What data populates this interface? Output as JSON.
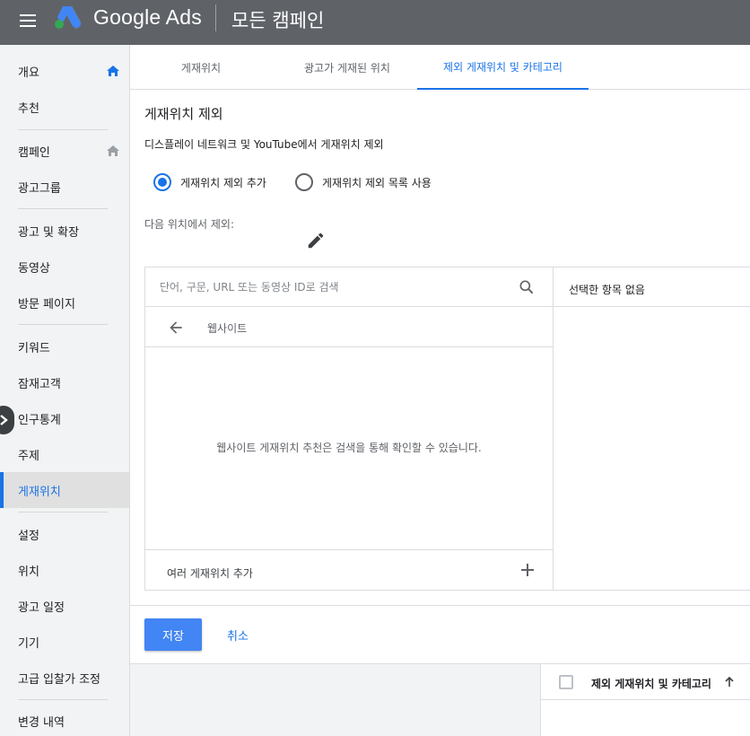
{
  "app": {
    "brand": "Google Ads",
    "page_title": "모든 캠페인"
  },
  "sidebar": {
    "items": [
      {
        "label": "개요"
      },
      {
        "label": "추천"
      },
      {
        "label": "캠페인"
      },
      {
        "label": "광고그룹"
      },
      {
        "label": "광고 및 확장"
      },
      {
        "label": "동영상"
      },
      {
        "label": "방문 페이지"
      },
      {
        "label": "키워드"
      },
      {
        "label": "잠재고객"
      },
      {
        "label": "인구통계"
      },
      {
        "label": "주제"
      },
      {
        "label": "게재위치"
      },
      {
        "label": "설정"
      },
      {
        "label": "위치"
      },
      {
        "label": "광고 일정"
      },
      {
        "label": "기기"
      },
      {
        "label": "고급 입찰가 조정"
      },
      {
        "label": "변경 내역"
      }
    ],
    "active_index": 11
  },
  "tabs": [
    {
      "label": "게재위치"
    },
    {
      "label": "광고가 게재된 위치"
    },
    {
      "label": "제외 게재위치 및 카테고리"
    }
  ],
  "active_tab": 2,
  "form": {
    "title": "게재위치 제외",
    "subtitle": "디스플레이 네트워크 및 YouTube에서 게재위치 제외",
    "radio_add": "게재위치 제외 추가",
    "radio_list": "게재위치 제외 목록 사용",
    "exclude_from_label": "다음 위치에서 제외:",
    "search_placeholder": "단어, 구문, URL 또는 동영상 ID로 검색",
    "back_label": "웹사이트",
    "empty_message": "웹사이트 게재위치 추천은 검색을 통해 확인할 수 있습니다.",
    "multi_add_label": "여러 게재위치 추가",
    "selected_none": "선택한 항목 없음",
    "save_label": "저장",
    "cancel_label": "취소"
  },
  "table": {
    "column_header": "제외 게재위치 및 카테고리"
  },
  "colors": {
    "topbar": "#5f6368",
    "accent": "#1a73e8",
    "save_button": "#4285f4"
  }
}
